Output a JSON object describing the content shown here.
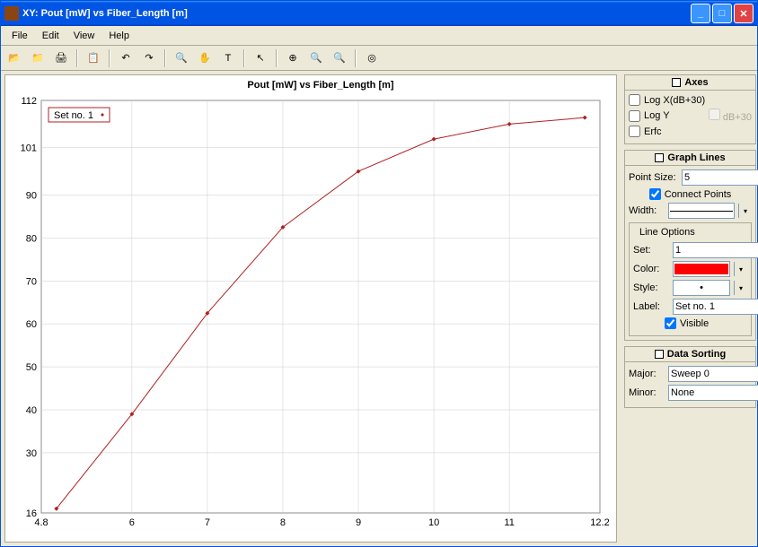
{
  "window": {
    "title": "XY: Pout [mW] vs Fiber_Length [m]"
  },
  "menu": {
    "file": "File",
    "edit": "Edit",
    "view": "View",
    "help": "Help"
  },
  "chart_data": {
    "type": "line",
    "title": "Pout [mW] vs Fiber_Length [m]",
    "legend": "Set no. 1",
    "x": [
      5,
      6,
      7,
      8,
      9,
      10,
      11,
      12
    ],
    "y": [
      17,
      39,
      62.5,
      82.5,
      95.5,
      103,
      106.5,
      108
    ],
    "xlabel": "",
    "ylabel": "",
    "xlim": [
      4.8,
      12.2
    ],
    "ylim": [
      16,
      112
    ],
    "xticks": [
      4.8,
      6,
      7,
      8,
      9,
      10,
      11,
      12.2
    ],
    "yticks": [
      16,
      30,
      40,
      50,
      60,
      70,
      80,
      90,
      101,
      112
    ],
    "series_color": "#b02020"
  },
  "axes": {
    "title": "Axes",
    "logx": "Log X(dB+30)",
    "logy": "Log Y",
    "db30": "dB+30",
    "erfc": "Erfc"
  },
  "graphlines": {
    "title": "Graph Lines",
    "pointsize_label": "Point Size:",
    "pointsize": "5",
    "connect": "Connect Points",
    "width_label": "Width:",
    "lineopts": "Line Options",
    "set_label": "Set:",
    "set": "1",
    "color_label": "Color:",
    "style_label": "Style:",
    "label_label": "Label:",
    "label": "Set no. 1",
    "visible": "Visible"
  },
  "sorting": {
    "title": "Data Sorting",
    "major_label": "Major:",
    "major": "Sweep 0",
    "minor_label": "Minor:",
    "minor": "None"
  }
}
